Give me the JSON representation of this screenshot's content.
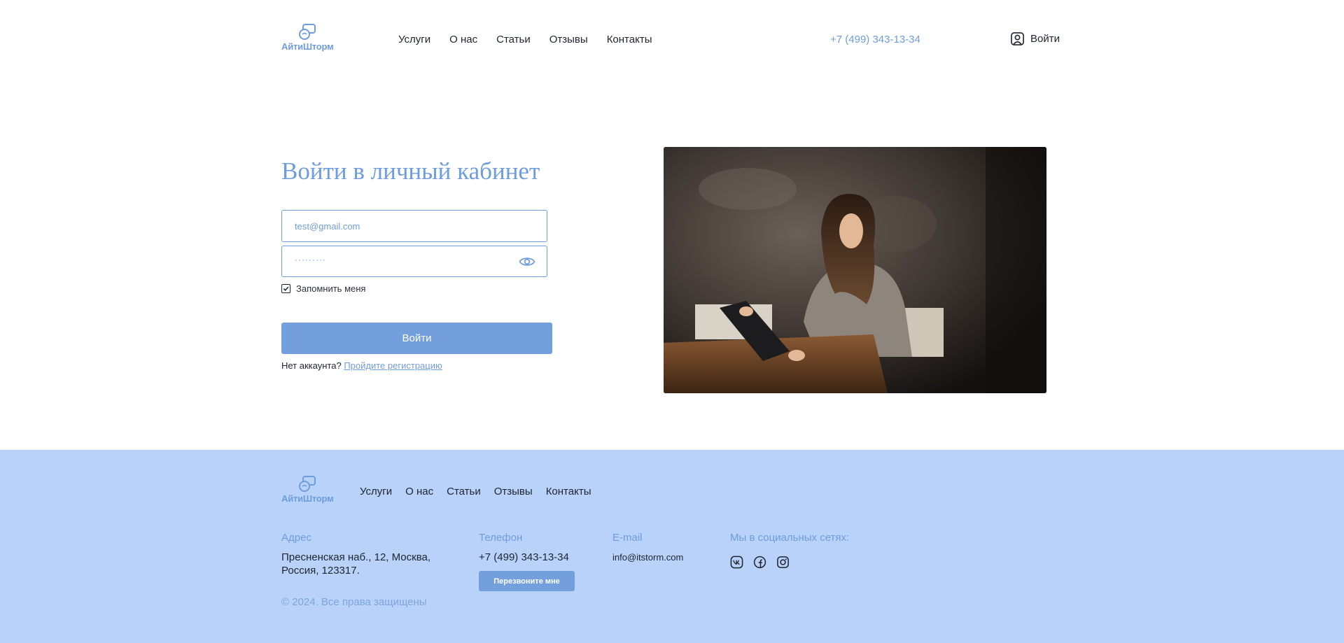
{
  "brand": {
    "name": "АйтиШторм",
    "accent_color": "#6f9cdb",
    "button_color": "#739fdd",
    "footer_bg": "#b8d2f9"
  },
  "header": {
    "nav": [
      "Услуги",
      "О нас",
      "Статьи",
      "Отзывы",
      "Контакты"
    ],
    "phone": "+7 (499) 343-13-34",
    "login_label": "Войти",
    "login_icon": "user-icon"
  },
  "main": {
    "title": "Войти в личный кабинет",
    "email_value": "test@gmail.com",
    "password_value": "·········",
    "password_icon": "eye-icon",
    "remember_label": "Запомнить меня",
    "remember_checked": true,
    "submit_label": "Войти",
    "no_account_text": "Нет аккаунта?",
    "signup_link": "Пройдите регистрацию"
  },
  "footer": {
    "nav": [
      "Услуги",
      "О нас",
      "Статьи",
      "Отзывы",
      "Контакты"
    ],
    "address_title": "Адрес",
    "address_line1": "Пресненская наб., 12, Москва,",
    "address_line2": "Россия, 123317.",
    "phone_title": "Телефон",
    "phone": "+7 (499) 343-13-34",
    "callback_label": "Перезвоните мне",
    "email_title": "E-mail",
    "email": "info@itstorm.com",
    "social_title": "Мы в социальных сетях:",
    "socials": [
      "vk-icon",
      "facebook-icon",
      "instagram-icon"
    ],
    "copyright": "© 2024. Все права защищены"
  }
}
